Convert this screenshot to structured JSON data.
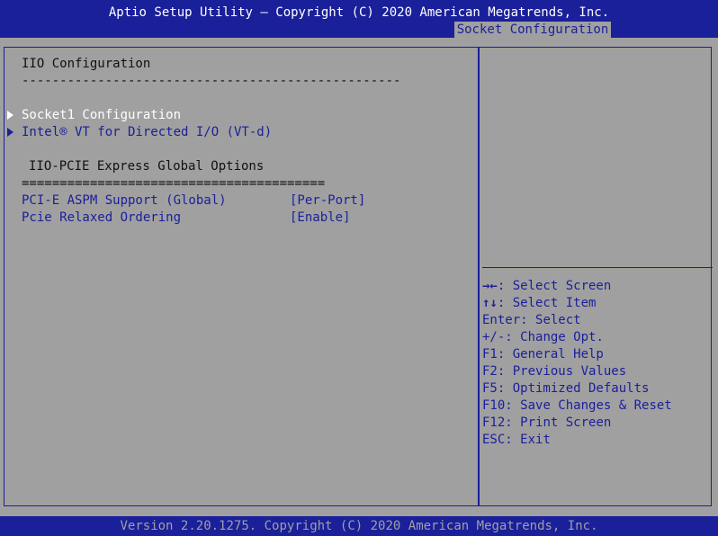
{
  "header": {
    "title": "Aptio Setup Utility – Copyright (C) 2020 American Megatrends, Inc.",
    "active_tab": "Socket Configuration"
  },
  "left_panel": {
    "section_title": "IIO Configuration",
    "section_rule": "--------------------------------------------------",
    "submenus": [
      {
        "label": "Socket1 Configuration",
        "selected": true
      },
      {
        "label": "Intel® VT for Directed I/O (VT-d)",
        "selected": false
      }
    ],
    "options_title": "IIO-PCIE Express Global Options",
    "options_rule": "========================================",
    "settings": [
      {
        "label": "PCI-E ASPM Support (Global)",
        "value": "[Per-Port]"
      },
      {
        "label": "Pcie Relaxed Ordering",
        "value": "[Enable]"
      }
    ]
  },
  "help_panel": {
    "keys": [
      {
        "key": "→←",
        "desc": ": Select Screen"
      },
      {
        "key": "↑↓",
        "desc": ": Select Item"
      },
      {
        "key": "Enter",
        "desc": ": Select"
      },
      {
        "key": "+/-",
        "desc": ": Change Opt."
      },
      {
        "key": "F1",
        "desc": ": General Help"
      },
      {
        "key": "F2",
        "desc": ": Previous Values"
      },
      {
        "key": "F5",
        "desc": ": Optimized Defaults"
      },
      {
        "key": "F10",
        "desc": ": Save Changes & Reset"
      },
      {
        "key": "F12",
        "desc": ": Print Screen"
      },
      {
        "key": "ESC",
        "desc": ": Exit"
      }
    ]
  },
  "footer": {
    "text": "Version 2.20.1275. Copyright (C) 2020 American Megatrends, Inc."
  },
  "colors": {
    "bios_blue": "#1a1f9a",
    "bios_gray": "#a0a0a0",
    "highlight_white": "#ffffff"
  }
}
